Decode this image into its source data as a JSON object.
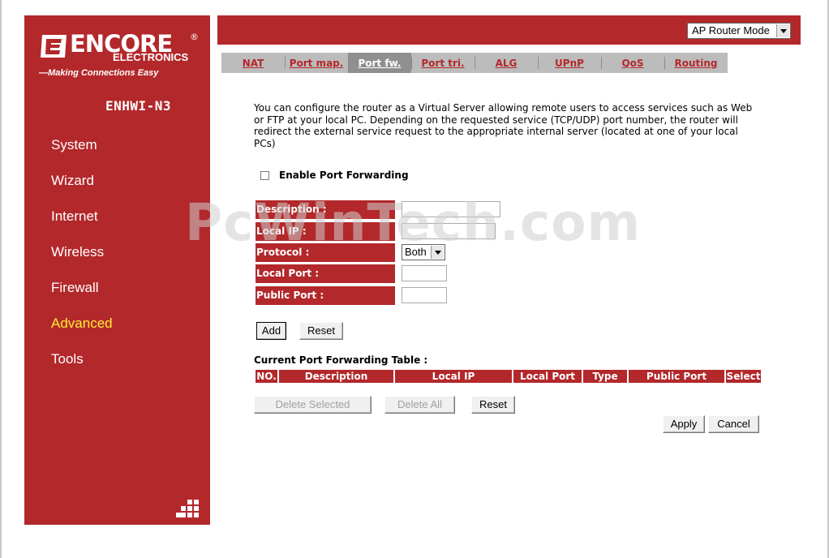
{
  "brand": {
    "name": "ENCORE",
    "sub": "ELECTRONICS",
    "registered": "®",
    "tagline": "—Making Connections Easy",
    "model": "ENHWI-N3"
  },
  "mode_select": {
    "value": "AP Router Mode"
  },
  "sidebar": {
    "items": [
      {
        "label": "System"
      },
      {
        "label": "Wizard"
      },
      {
        "label": "Internet"
      },
      {
        "label": "Wireless"
      },
      {
        "label": "Firewall"
      },
      {
        "label": "Advanced",
        "active": true
      },
      {
        "label": "Tools"
      }
    ]
  },
  "tabs": [
    {
      "label": "NAT"
    },
    {
      "label": "Port map."
    },
    {
      "label": "Port fw.",
      "active": true
    },
    {
      "label": "Port tri."
    },
    {
      "label": "ALG"
    },
    {
      "label": "UPnP"
    },
    {
      "label": "QoS"
    },
    {
      "label": "Routing"
    }
  ],
  "content": {
    "description": "You can configure the router as a Virtual Server allowing remote users to access services such as Web or FTP at your local PC. Depending on the requested service (TCP/UDP) port number, the router will redirect the external service request to the appropriate internal server (located at one of your local PCs)",
    "enable_label": "Enable Port Forwarding",
    "fields": {
      "description_label": "Description :",
      "local_ip_label": "Local IP :",
      "protocol_label": "Protocol :",
      "protocol_value": "Both",
      "local_port_label": "Local Port :",
      "public_port_label": "Public Port :"
    },
    "buttons": {
      "add": "Add",
      "reset": "Reset",
      "delete_selected": "Delete Selected",
      "delete_all": "Delete All",
      "reset2": "Reset",
      "apply": "Apply",
      "cancel": "Cancel"
    },
    "table_title": "Current Port Forwarding Table :",
    "table_headers": [
      "NO.",
      "Description",
      "Local IP",
      "Local Port",
      "Type",
      "Public Port",
      "Select"
    ]
  },
  "watermark": "PcWinTech.com",
  "colors": {
    "accent_red": "#b3282b",
    "active_nav": "#ffee33",
    "tab_bg": "#bcbcbc"
  }
}
